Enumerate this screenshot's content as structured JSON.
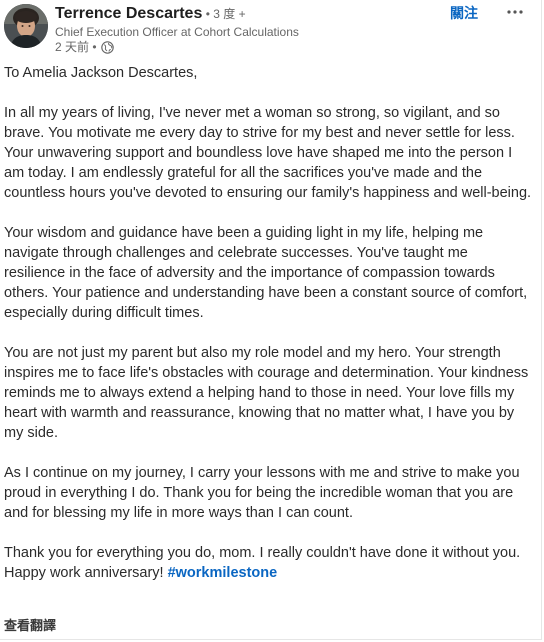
{
  "header": {
    "author_name": "Terrence Descartes",
    "degree": " • 3 度 +",
    "headline": "Chief Execution Officer at Cohort Calculations",
    "post_time": "2 天前 •",
    "visibility_icon": "globe-icon",
    "follow_label": "關注",
    "more_icon": "more-horizontal-icon"
  },
  "post": {
    "salutation": "To Amelia Jackson Descartes,",
    "paragraphs": [
      "In all my years of living, I've never met a woman so strong, so vigilant, and so brave. You motivate me every day to strive for my best and never settle for less. Your unwavering support and boundless love have shaped me into the person I am today. I am endlessly grateful for all the sacrifices you've made and the countless hours you've devoted to ensuring our family's happiness and well-being.",
      "Your wisdom and guidance have been a guiding light in my life, helping me navigate through challenges and celebrate successes. You've taught me resilience in the face of adversity and the importance of compassion towards others. Your patience and understanding have been a constant source of comfort, especially during difficult times.",
      "You are not just my parent but also my role model and my hero. Your strength inspires me to face life's obstacles with courage and determination. Your kindness reminds me to always extend a helping hand to those in need. Your love fills my heart with warmth and reassurance, knowing that no matter what, I have you by my side.",
      "As I continue on my journey, I carry your lessons with me and strive to make you proud in everything I do. Thank you for being the incredible woman that you are and for blessing my life in more ways than I can count."
    ],
    "closing": "Thank you for everything you do, mom. I really couldn't have done it without you. Happy work anniversary! ",
    "hashtag": "#workmilestone",
    "translate_label": "查看翻譯"
  },
  "colors": {
    "link": "#0a66c2",
    "secondary_text": "#666666",
    "body_text": "#2b2b2b"
  }
}
